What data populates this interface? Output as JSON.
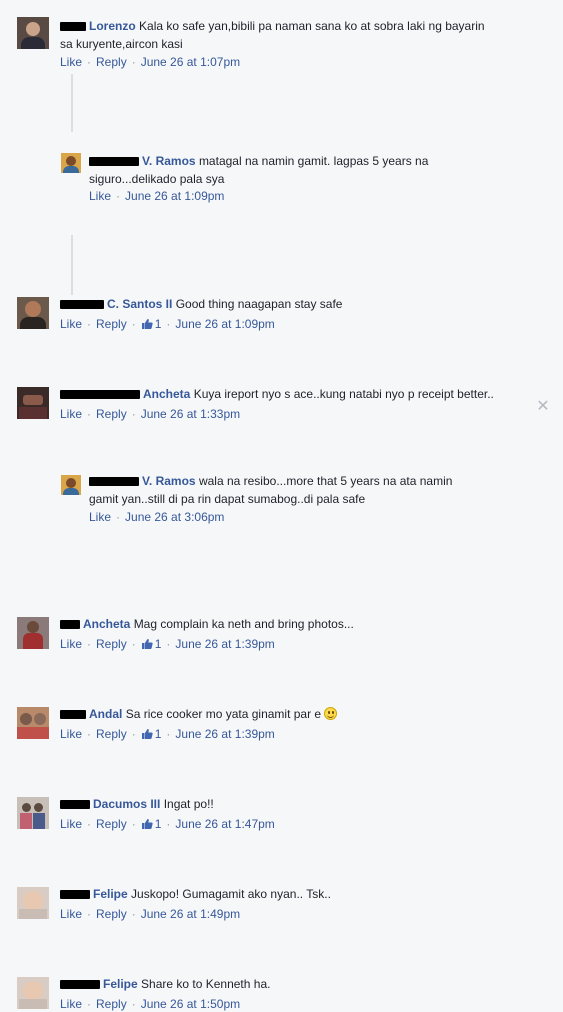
{
  "ui": {
    "like": "Like",
    "reply": "Reply",
    "dot": "·",
    "colors": {
      "link": "#365899",
      "muted": "#90949c",
      "bg": "#f6f7f9"
    }
  },
  "comments": [
    {
      "author": "Lorenzo",
      "text1": "Kala ko safe yan,bibili pa naman sana ko at sobra laki ng bayarin",
      "text2": "sa kuryente,aircon kasi",
      "likes": "",
      "time": "June 26 at 1:07pm"
    },
    {
      "author": "V. Ramos",
      "text1": "matagal na namin gamit. lagpas 5 years na",
      "text2": "siguro...delikado pala sya",
      "likes": "",
      "time": "June 26 at 1:09pm"
    },
    {
      "author": "C. Santos II",
      "text1": "Good thing naagapan stay safe",
      "likes": "1",
      "time": "June 26 at 1:09pm"
    },
    {
      "author": "Ancheta",
      "text1": "Kuya ireport nyo s ace..kung natabi nyo p receipt better..",
      "likes": "",
      "time": "June 26 at 1:33pm"
    },
    {
      "author": "V. Ramos",
      "text1": "wala na resibo...more that 5 years na ata namin",
      "text2": "gamit yan..still di pa rin dapat sumabog..di pala safe",
      "likes": "",
      "time": "June 26 at 3:06pm"
    },
    {
      "author": "Ancheta",
      "text1": "Mag complain ka neth and bring photos...",
      "likes": "1",
      "time": "June 26 at 1:39pm"
    },
    {
      "author": "Andal",
      "text1": "Sa rice cooker mo yata ginamit par e",
      "likes": "1",
      "time": "June 26 at 1:39pm"
    },
    {
      "author": "Dacumos III",
      "text1": "Ingat po!!",
      "likes": "1",
      "time": "June 26 at 1:47pm"
    },
    {
      "author": "Felipe",
      "text1": "Juskopo! Gumagamit ako nyan.. Tsk..",
      "likes": "",
      "time": "June 26 at 1:49pm"
    },
    {
      "author": "Felipe",
      "text1": "Share ko to Kenneth ha.",
      "likes": "",
      "time": "June 26 at 1:50pm"
    }
  ]
}
